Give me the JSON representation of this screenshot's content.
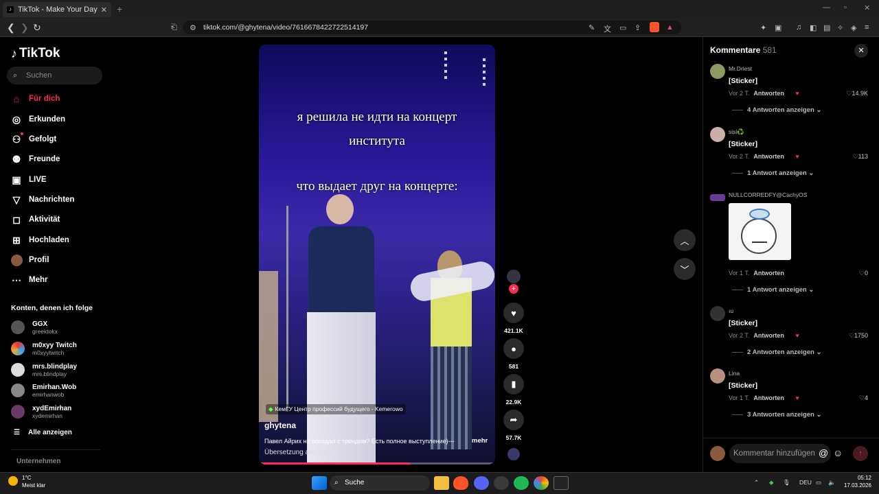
{
  "browser": {
    "tab_title": "TikTok - Make Your Day",
    "tab_close": "✕",
    "new_tab": "+",
    "url": "tiktok.com/@ghytena/video/7616678422722514197"
  },
  "sidebar": {
    "logo": "TikTok",
    "search_placeholder": "Suchen",
    "nav": [
      {
        "label": "Für dich",
        "icon": "home-icon"
      },
      {
        "label": "Erkunden",
        "icon": "compass-icon"
      },
      {
        "label": "Gefolgt",
        "icon": "following-icon"
      },
      {
        "label": "Freunde",
        "icon": "friends-icon"
      },
      {
        "label": "LIVE",
        "icon": "live-icon"
      },
      {
        "label": "Nachrichten",
        "icon": "messages-icon"
      },
      {
        "label": "Aktivität",
        "icon": "activity-icon"
      },
      {
        "label": "Hochladen",
        "icon": "upload-icon"
      },
      {
        "label": "Profil",
        "icon": "profile-icon"
      },
      {
        "label": "Mehr",
        "icon": "more-icon"
      }
    ],
    "following_header": "Konten, denen ich folge",
    "following": [
      {
        "name": "GGX",
        "user": "greektokx"
      },
      {
        "name": "m0xyy Twitch",
        "user": "m0xyytwitch"
      },
      {
        "name": "mrs.blindplay",
        "user": "mrs.blindplay"
      },
      {
        "name": "Emirhan.Wob",
        "user": "emirhanwob"
      },
      {
        "name": "xydEmirhan",
        "user": "xydemirhan"
      }
    ],
    "show_all": "Alle anzeigen",
    "company": "Unternehmen"
  },
  "video": {
    "caption1": "я решила не идти на концерт",
    "caption2": "института",
    "caption3": "что выдает друг на концерте:",
    "location": "КемГУ Центр профессий будущего - Kemerowo",
    "author": "ghytena",
    "description": "Павел Айрих не опоздал с трендом? Есть полное выступление)---",
    "more": "mehr",
    "translate": "Übersetzung anzeigen",
    "progress": 0.64
  },
  "actions": {
    "likes": "421.1K",
    "comments": "581",
    "saves": "22.9K",
    "shares": "57.7K"
  },
  "comments_panel": {
    "title": "Kommentare",
    "count": "581",
    "close": "✕",
    "input_placeholder": "Kommentar hinzufügen",
    "comments": [
      {
        "user": "Mr.Driest",
        "text": "[Sticker]",
        "time": "Vor 2 T.",
        "reply": "Antworten",
        "likes": "14.9K",
        "more": "4 Antworten anzeigen"
      },
      {
        "user": "sisi♻️",
        "text": "[Sticker]",
        "time": "Vor 2 T.",
        "reply": "Antworten",
        "likes": "113",
        "more": "1 Antwort anzeigen"
      },
      {
        "user": "NULLCORREDFY@CachyOS",
        "text": "",
        "time": "Vor 1 T.",
        "reply": "Antworten",
        "likes": "0",
        "more": "1 Antwort anzeigen"
      },
      {
        "user": "ıu",
        "text": "[Sticker]",
        "time": "Vor 2 T.",
        "reply": "Antworten",
        "likes": "1750",
        "more": "2 Antworten anzeigen"
      },
      {
        "user": "Lina",
        "text": "[Sticker]",
        "time": "Vor 1 T.",
        "reply": "Antworten",
        "likes": "4",
        "more": "3 Antworten anzeigen"
      }
    ]
  },
  "taskbar": {
    "temp": "1°C",
    "weather": "Meist klar",
    "search": "Suche",
    "lang": "DEU",
    "time": "05:12",
    "date": "17.03.2026"
  }
}
